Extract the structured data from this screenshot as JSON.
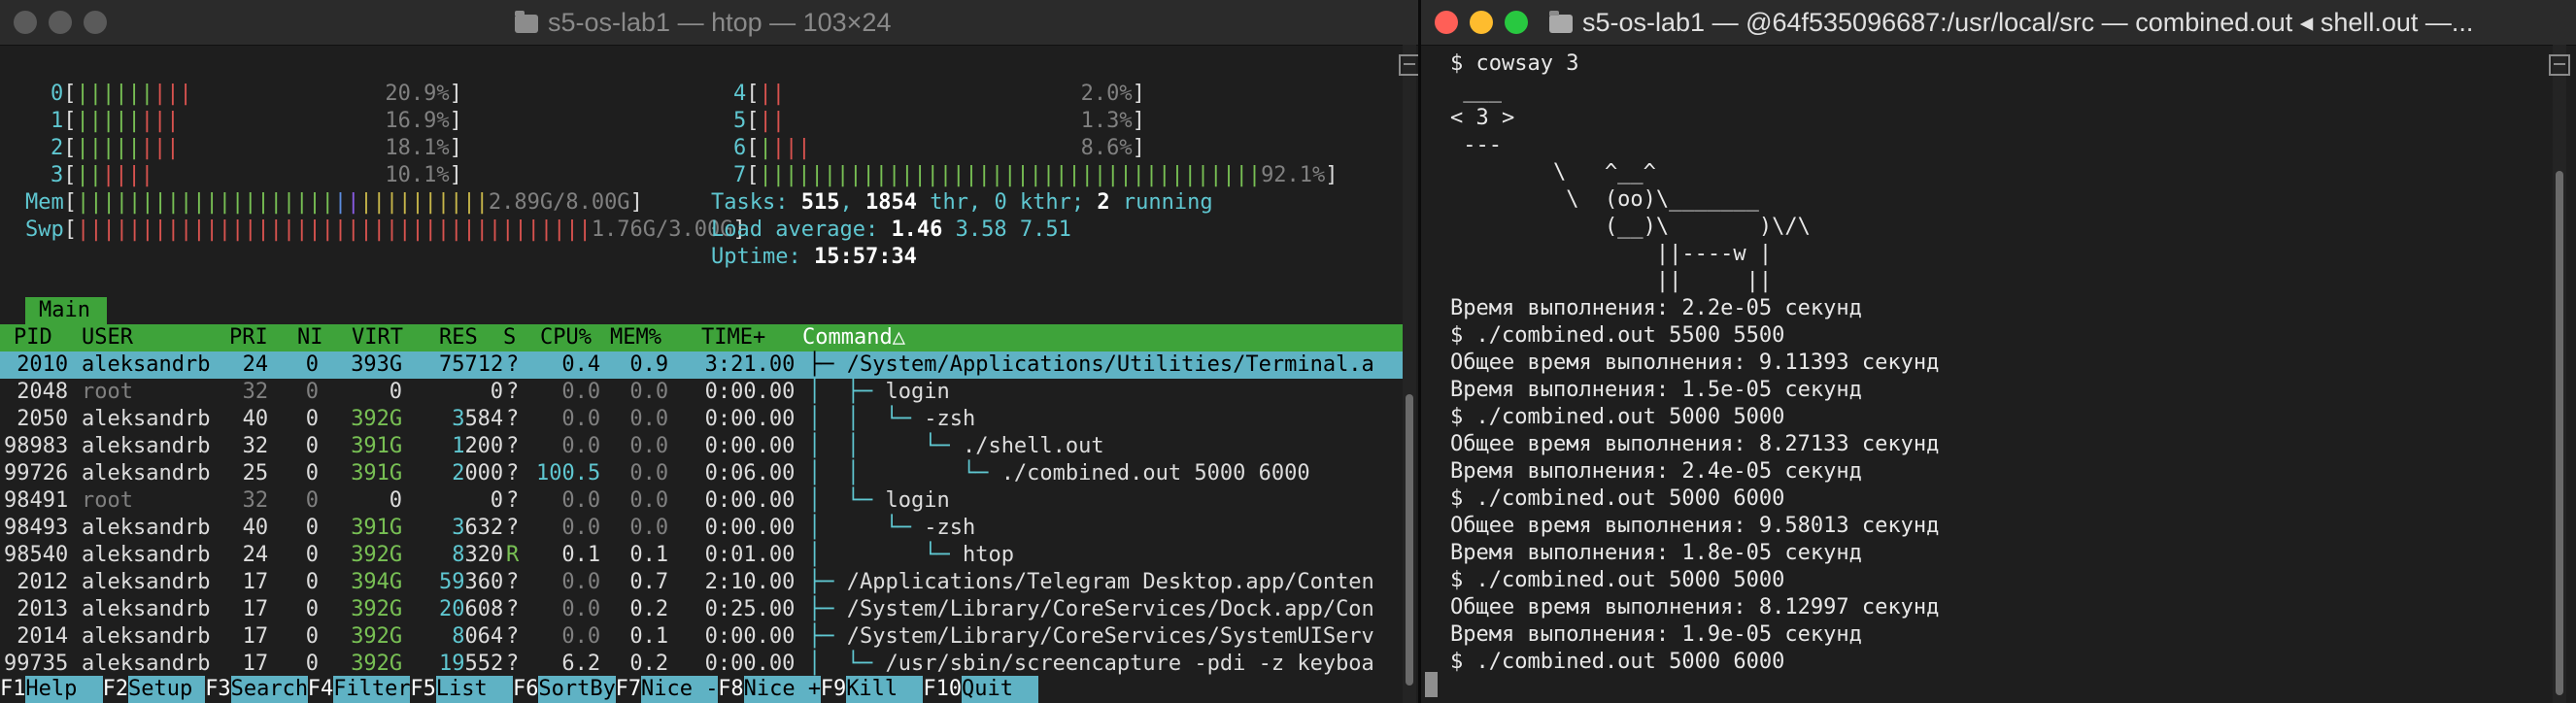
{
  "left_window": {
    "title": "s5-os-lab1 — htop — 103×24",
    "cpus": [
      {
        "id": "0",
        "bars": [
          [
            "grn",
            "||||||"
          ],
          [
            "red",
            "|||"
          ]
        ],
        "pct": "20.9%"
      },
      {
        "id": "1",
        "bars": [
          [
            "grn",
            "|||||"
          ],
          [
            "red",
            "|||"
          ]
        ],
        "pct": "16.9%"
      },
      {
        "id": "2",
        "bars": [
          [
            "grn",
            "|||||"
          ],
          [
            "red",
            "|||"
          ]
        ],
        "pct": "18.1%"
      },
      {
        "id": "3",
        "bars": [
          [
            "grn",
            "||"
          ],
          [
            "red",
            "||||"
          ]
        ],
        "pct": "10.1%"
      },
      {
        "id": "4",
        "bars": [
          [
            "red",
            "||"
          ]
        ],
        "pct": "2.0%"
      },
      {
        "id": "5",
        "bars": [
          [
            "red",
            "||"
          ]
        ],
        "pct": "1.3%"
      },
      {
        "id": "6",
        "bars": [
          [
            "grn",
            "|"
          ],
          [
            "red",
            "|||"
          ]
        ],
        "pct": "8.6%"
      },
      {
        "id": "7",
        "bars": [
          [
            "grn",
            "|||||||||||||||||||||||||||||||||||||||"
          ]
        ],
        "pct": "92.1%"
      }
    ],
    "mem": {
      "label": "Mem",
      "value": "2.89G/8.00G"
    },
    "swp": {
      "label": "Swp",
      "value": "1.76G/3.00G"
    },
    "tasks": {
      "label": "Tasks:",
      "count": "515",
      "thr": "1854",
      "thr_label": " thr, ",
      "kthr": "0",
      "kthr_label": " kthr; ",
      "running": "2",
      "running_label": " running"
    },
    "load": {
      "label": "Load average:",
      "v1": "1.46",
      "v2": "3.58",
      "v3": "7.51"
    },
    "uptime": {
      "label": "Uptime:",
      "value": "15:57:34"
    },
    "tab": "Main",
    "columns": {
      "pid": "PID",
      "user": "USER",
      "pri": "PRI",
      "ni": "NI",
      "virt": "VIRT",
      "res": "RES",
      "s": "S",
      "cpu": "CPU%",
      "mem": "MEM%",
      "time": "TIME+",
      "command": "Command△"
    },
    "processes": [
      {
        "pid": "2010",
        "user": "aleksandrb",
        "pri": "24",
        "ni": "0",
        "virt": "393G",
        "res": "75712",
        "s": "?",
        "cpu": "0.4",
        "mem": "0.9",
        "time": "3:21.00",
        "tree": "├─ ",
        "cmd": "/System/Applications/Utilities/Terminal.a",
        "selected": true
      },
      {
        "pid": "2048",
        "user": "root",
        "pri": "32",
        "ni": "0",
        "virt": "0",
        "res": "0",
        "s": "?",
        "cpu": "0.0",
        "mem": "0.0",
        "time": "0:00.00",
        "tree": "│  ├─ ",
        "cmd": "login"
      },
      {
        "pid": "2050",
        "user": "aleksandrb",
        "pri": "40",
        "ni": "0",
        "virt": "392G",
        "res": "3584",
        "s": "?",
        "cpu": "0.0",
        "mem": "0.0",
        "time": "0:00.00",
        "tree": "│  │  └─ ",
        "cmd": "-zsh"
      },
      {
        "pid": "98983",
        "user": "aleksandrb",
        "pri": "32",
        "ni": "0",
        "virt": "391G",
        "res": "1200",
        "s": "?",
        "cpu": "0.0",
        "mem": "0.0",
        "time": "0:00.00",
        "tree": "│  │     └─ ",
        "cmd": "./shell.out"
      },
      {
        "pid": "99726",
        "user": "aleksandrb",
        "pri": "25",
        "ni": "0",
        "virt": "391G",
        "res": "2000",
        "s": "?",
        "cpu": "100.5",
        "mem": "0.0",
        "time": "0:06.00",
        "tree": "│  │        └─ ",
        "cmd": "./combined.out 5000 6000"
      },
      {
        "pid": "98491",
        "user": "root",
        "pri": "32",
        "ni": "0",
        "virt": "0",
        "res": "0",
        "s": "?",
        "cpu": "0.0",
        "mem": "0.0",
        "time": "0:00.00",
        "tree": "│  └─ ",
        "cmd": "login"
      },
      {
        "pid": "98493",
        "user": "aleksandrb",
        "pri": "40",
        "ni": "0",
        "virt": "391G",
        "res": "3632",
        "s": "?",
        "cpu": "0.0",
        "mem": "0.0",
        "time": "0:00.00",
        "tree": "│     └─ ",
        "cmd": "-zsh"
      },
      {
        "pid": "98540",
        "user": "aleksandrb",
        "pri": "24",
        "ni": "0",
        "virt": "392G",
        "res": "8320",
        "s": "R",
        "cpu": "0.1",
        "mem": "0.1",
        "time": "0:01.00",
        "tree": "│        └─ ",
        "cmd": "htop"
      },
      {
        "pid": "2012",
        "user": "aleksandrb",
        "pri": "17",
        "ni": "0",
        "virt": "394G",
        "res": "59360",
        "s": "?",
        "cpu": "0.0",
        "mem": "0.7",
        "time": "2:10.00",
        "tree": "├─ ",
        "cmd": "/Applications/Telegram Desktop.app/Conten"
      },
      {
        "pid": "2013",
        "user": "aleksandrb",
        "pri": "17",
        "ni": "0",
        "virt": "392G",
        "res": "20608",
        "s": "?",
        "cpu": "0.0",
        "mem": "0.2",
        "time": "0:25.00",
        "tree": "├─ ",
        "cmd": "/System/Library/CoreServices/Dock.app/Con"
      },
      {
        "pid": "2014",
        "user": "aleksandrb",
        "pri": "17",
        "ni": "0",
        "virt": "392G",
        "res": "8064",
        "s": "?",
        "cpu": "0.0",
        "mem": "0.1",
        "time": "0:00.00",
        "tree": "├─ ",
        "cmd": "/System/Library/CoreServices/SystemUIServ"
      },
      {
        "pid": "99735",
        "user": "aleksandrb",
        "pri": "17",
        "ni": "0",
        "virt": "392G",
        "res": "19552",
        "s": "?",
        "cpu": "6.2",
        "mem": "0.2",
        "time": "0:00.00",
        "tree": "│  └─ ",
        "cmd": "/usr/sbin/screencapture -pdi -z keyboa"
      }
    ],
    "fkeys": [
      {
        "key": "F1",
        "label": "Help"
      },
      {
        "key": "F2",
        "label": "Setup"
      },
      {
        "key": "F3",
        "label": "Search"
      },
      {
        "key": "F4",
        "label": "Filter"
      },
      {
        "key": "F5",
        "label": "List"
      },
      {
        "key": "F6",
        "label": "SortBy"
      },
      {
        "key": "F7",
        "label": "Nice -"
      },
      {
        "key": "F8",
        "label": "Nice +"
      },
      {
        "key": "F9",
        "label": "Kill"
      },
      {
        "key": "F10",
        "label": "Quit"
      }
    ]
  },
  "right_window": {
    "title": "s5-os-lab1 — @64f535096687:/usr/local/src — combined.out ◂ shell.out —...",
    "lines": [
      "$ cowsay 3",
      " ___",
      "< 3 >",
      " ---",
      "        \\   ^__^",
      "         \\  (oo)\\_______",
      "            (__)\\       )\\/\\",
      "                ||----w |",
      "                ||     ||",
      "Время выполнения: 2.2e-05 секунд",
      "$ ./combined.out 5500 5500",
      "Общее время выполнения: 9.11393 секунд",
      "Время выполнения: 1.5e-05 секунд",
      "$ ./combined.out 5000 5000",
      "Общее время выполнения: 8.27133 секунд",
      "Время выполнения: 2.4e-05 секунд",
      "$ ./combined.out 5000 6000",
      "Общее время выполнения: 9.58013 секунд",
      "Время выполнения: 1.8e-05 секунд",
      "$ ./combined.out 5000 5000",
      "Общее время выполнения: 8.12997 секунд",
      "Время выполнения: 1.9e-05 секунд",
      "$ ./combined.out 5000 6000"
    ]
  },
  "colors": {
    "close": "#ff5f57",
    "minimize": "#febc2e",
    "zoom": "#28c840",
    "header_green": "#3ea33a",
    "selection": "#5fb2c4"
  }
}
